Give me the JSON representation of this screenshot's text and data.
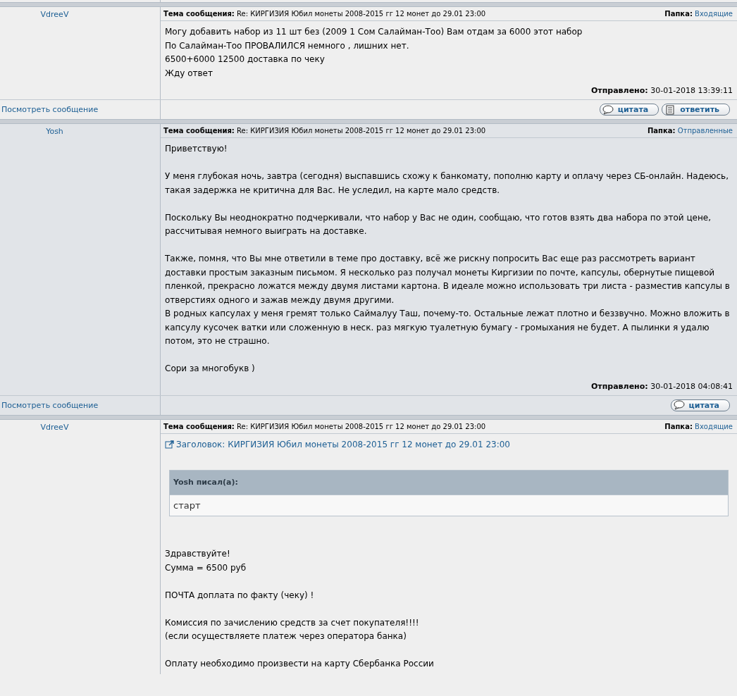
{
  "messages": [
    {
      "author": "VdreeV",
      "subject_label": "Тема сообщения:",
      "subject": "Re: КИРГИЗИЯ Юбил монеты 2008-2015 гг 12 монет до 29.01 23:00",
      "folder_label": "Папка:",
      "folder": "Входящие",
      "highlighted": false,
      "blocks": [
        [
          "Могу добавить набор из 11 шт без (2009 1 Сом Салайман-Тоо) Вам отдам за 6000 этот набор",
          "По Салайман-Тоо ПРОВАЛИЛСЯ немного , лишних нет.",
          "6500+6000 12500 доставка по чеку",
          "Жду ответ"
        ]
      ],
      "sent_label": "Отправлено:",
      "sent": "30-01-2018 13:39:11",
      "view_link": "Посмотреть сообщение",
      "buttons": [
        {
          "kind": "quote",
          "label": "цитата"
        },
        {
          "kind": "reply",
          "label": "ответить"
        }
      ]
    },
    {
      "author": "Yosh",
      "subject_label": "Тема сообщения:",
      "subject": "Re: КИРГИЗИЯ Юбил монеты 2008-2015 гг 12 монет до 29.01 23:00",
      "folder_label": "Папка:",
      "folder": "Отправленные",
      "highlighted": true,
      "blocks": [
        [
          "Приветствую!"
        ],
        [
          "У меня глубокая ночь, завтра (сегодня) выспавшись схожу к банкомату, пополню карту и оплачу через СБ-онлайн. Надеюсь, такая задержка не критична для Вас. Не уследил, на карте мало средств."
        ],
        [
          "Поскольку Вы неоднократно подчеркивали, что набор у Вас не один, сообщаю, что готов взять два набора по этой цене, рассчитывая немного выиграть на доставке."
        ],
        [
          "Также, помня, что Вы мне ответили в теме про доставку, всё же рискну попросить Вас еще раз рассмотреть вариант доставки простым заказным письмом. Я несколько раз получал монеты Киргизии по почте, капсулы, обернутые пищевой пленкой, прекрасно ложатся между двумя листами картона. В идеале можно использовать три листа - разместив капсулы в отверстиях одного и зажав между двумя другими.",
          "В родных капсулах у меня гремят только Саймалуу Таш, почему-то. Остальные лежат плотно и беззвучно. Можно вложить в капсулу кусочек ватки или сложенную в неск. раз мягкую туалетную бумагу - громыхания не будет. А пылинки я удалю потом, это не страшно."
        ],
        [
          "Сори за многобукв )"
        ]
      ],
      "sent_label": "Отправлено:",
      "sent": "30-01-2018 04:08:41",
      "view_link": "Посмотреть сообщение",
      "buttons": [
        {
          "kind": "quote",
          "label": "цитата"
        }
      ]
    },
    {
      "author": "VdreeV",
      "subject_label": "Тема сообщения:",
      "subject": "Re: КИРГИЗИЯ Юбил монеты 2008-2015 гг 12 монет до 29.01 23:00",
      "folder_label": "Папка:",
      "folder": "Входящие",
      "highlighted": false,
      "quote_link": "Заголовок: КИРГИЗИЯ Юбил монеты 2008-2015 гг 12 монет до 29.01 23:00",
      "quote": {
        "title": "Yosh писал(а):",
        "text": "старт"
      },
      "blocks": [
        [
          "Здравствуйте!",
          "Сумма = 6500 руб"
        ],
        [
          "ПОЧТА доплата по факту (чеку) !"
        ],
        [
          "Комиссия по зачислению средств за счет покупателя!!!!",
          "(если осуществляете платеж через оператора банка)"
        ],
        [
          "Оплату необходимо произвести на карту Сбербанка России"
        ]
      ]
    }
  ]
}
